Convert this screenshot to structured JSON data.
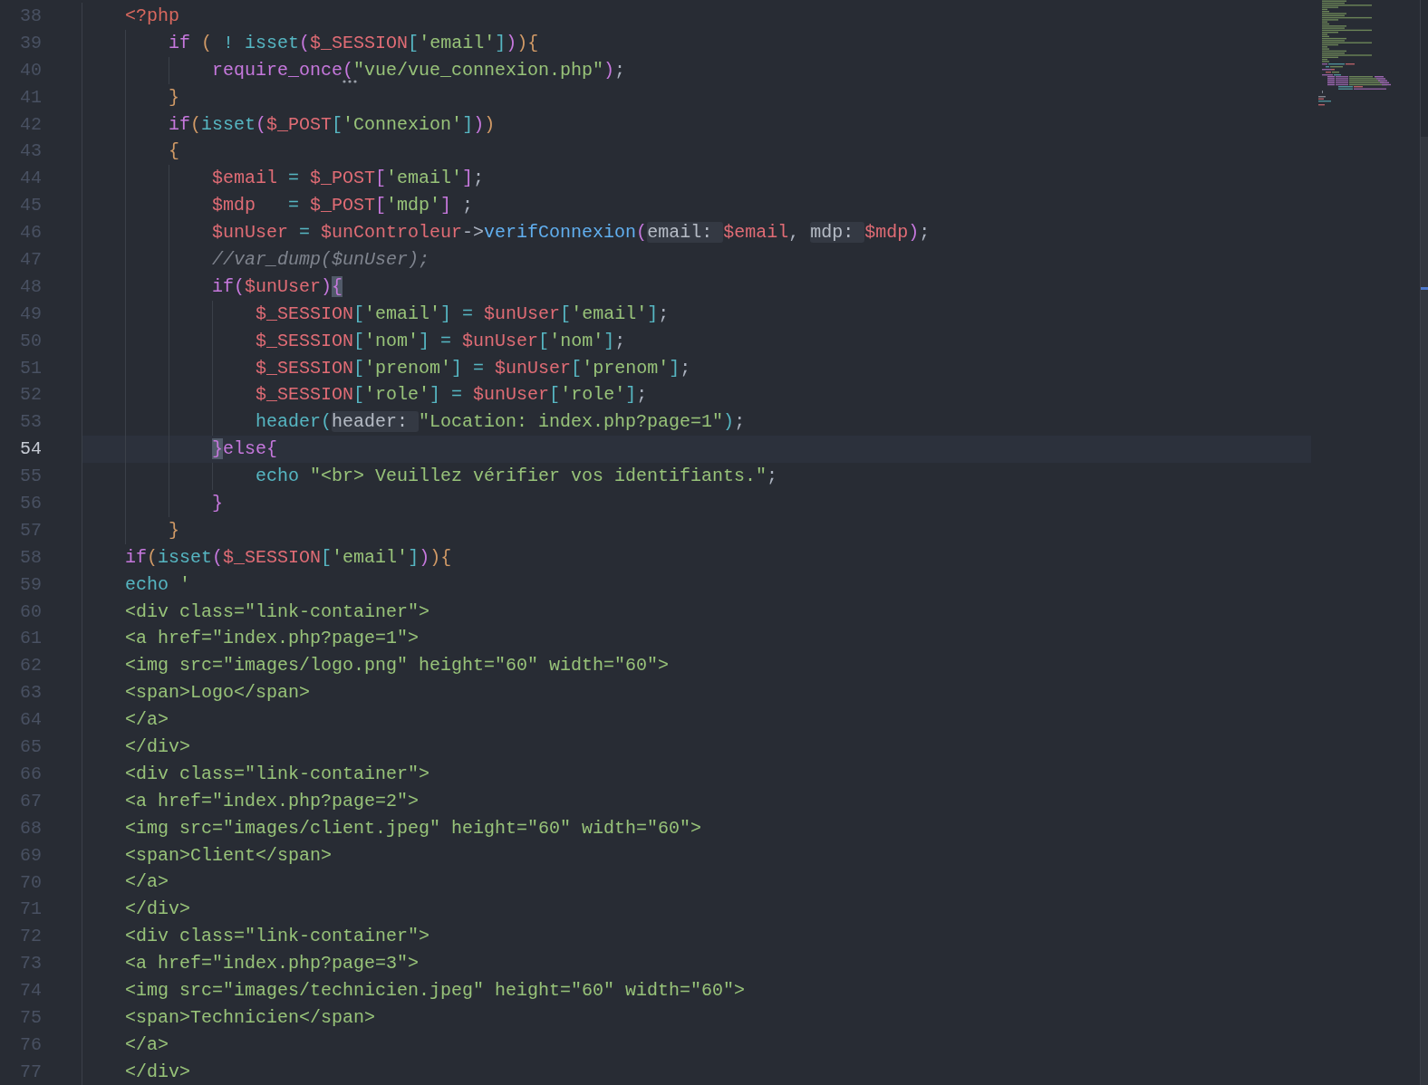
{
  "editor": {
    "lines": [
      {
        "number": "38",
        "selected": false,
        "tokens": [
          {
            "kind": "tag",
            "text": "<?php"
          }
        ],
        "children": [
          {
            "number": "39",
            "selected": false,
            "tokens": [
              {
                "kind": "keyword",
                "text": "if "
              },
              {
                "kind": "bracket1",
                "text": "( "
              },
              {
                "kind": "operator",
                "text": "! "
              },
              {
                "kind": "builtin",
                "text": "isset"
              },
              {
                "kind": "bracket2",
                "text": "("
              },
              {
                "kind": "variable",
                "text": "$_SESSION"
              },
              {
                "kind": "bracket3",
                "text": "["
              },
              {
                "kind": "string",
                "text": "'email'"
              },
              {
                "kind": "bracket3",
                "text": "]"
              },
              {
                "kind": "bracket2",
                "text": ")"
              },
              {
                "kind": "bracket1",
                "text": "){"
              }
            ],
            "children": [
              {
                "number": "40",
                "selected": false,
                "tokens": [
                  {
                    "kind": "keyword",
                    "text": "require_once"
                  },
                  {
                    "kind": "bracket2",
                    "text": "(",
                    "hinted": true
                  },
                  {
                    "kind": "string",
                    "text": "\"vue/vue_connexion.php\""
                  },
                  {
                    "kind": "bracket2",
                    "text": ")"
                  },
                  {
                    "kind": "plain",
                    "text": ";"
                  }
                ]
              }
            ]
          },
          {
            "number": "41",
            "selected": false,
            "tokens": [
              {
                "kind": "bracket1",
                "text": "}"
              }
            ]
          },
          {
            "number": "42",
            "selected": false,
            "tokens": [
              {
                "kind": "keyword",
                "text": "if"
              },
              {
                "kind": "bracket1",
                "text": "("
              },
              {
                "kind": "builtin",
                "text": "isset"
              },
              {
                "kind": "bracket2",
                "text": "("
              },
              {
                "kind": "variable",
                "text": "$_POST"
              },
              {
                "kind": "bracket3",
                "text": "["
              },
              {
                "kind": "string",
                "text": "'Connexion'"
              },
              {
                "kind": "bracket3",
                "text": "]"
              },
              {
                "kind": "bracket2",
                "text": ")"
              },
              {
                "kind": "bracket1",
                "text": ")"
              }
            ]
          },
          {
            "number": "43",
            "selected": false,
            "tokens": [
              {
                "kind": "bracket1",
                "text": "{"
              }
            ],
            "children": [
              {
                "number": "44",
                "selected": false,
                "tokens": [
                  {
                    "kind": "variable",
                    "text": "$email "
                  },
                  {
                    "kind": "operator",
                    "text": "= "
                  },
                  {
                    "kind": "variable",
                    "text": "$_POST"
                  },
                  {
                    "kind": "bracket2",
                    "text": "["
                  },
                  {
                    "kind": "string",
                    "text": "'email'"
                  },
                  {
                    "kind": "bracket2",
                    "text": "]"
                  },
                  {
                    "kind": "plain",
                    "text": ";"
                  }
                ]
              },
              {
                "number": "45",
                "selected": false,
                "tokens": [
                  {
                    "kind": "variable",
                    "text": "$mdp   "
                  },
                  {
                    "kind": "operator",
                    "text": "= "
                  },
                  {
                    "kind": "variable",
                    "text": "$_POST"
                  },
                  {
                    "kind": "bracket2",
                    "text": "["
                  },
                  {
                    "kind": "string",
                    "text": "'mdp'"
                  },
                  {
                    "kind": "bracket2",
                    "text": "]"
                  },
                  {
                    "kind": "plain",
                    "text": " ;"
                  }
                ]
              },
              {
                "number": "46",
                "selected": false,
                "tokens": [
                  {
                    "kind": "variable",
                    "text": "$unUser "
                  },
                  {
                    "kind": "operator",
                    "text": "= "
                  },
                  {
                    "kind": "variable",
                    "text": "$unControleur"
                  },
                  {
                    "kind": "plain",
                    "text": "->"
                  },
                  {
                    "kind": "method",
                    "text": "verifConnexion"
                  },
                  {
                    "kind": "bracket2",
                    "text": "("
                  },
                  {
                    "kind": "hint",
                    "text": "email:"
                  },
                  {
                    "kind": "variable",
                    "text": "$email"
                  },
                  {
                    "kind": "plain",
                    "text": ", "
                  },
                  {
                    "kind": "hint",
                    "text": "mdp:"
                  },
                  {
                    "kind": "variable",
                    "text": "$mdp"
                  },
                  {
                    "kind": "bracket2",
                    "text": ")"
                  },
                  {
                    "kind": "plain",
                    "text": ";"
                  }
                ]
              },
              {
                "number": "47",
                "selected": false,
                "tokens": [
                  {
                    "kind": "comment",
                    "text": "//var_dump($unUser);"
                  }
                ]
              },
              {
                "number": "48",
                "selected": false,
                "tokens": [
                  {
                    "kind": "keyword",
                    "text": "if"
                  },
                  {
                    "kind": "bracket2",
                    "text": "("
                  },
                  {
                    "kind": "variable",
                    "text": "$unUser"
                  },
                  {
                    "kind": "bracket2",
                    "text": ")"
                  },
                  {
                    "kind": "match",
                    "text": "{"
                  }
                ],
                "children": [
                  {
                    "number": "49",
                    "selected": false,
                    "tokens": [
                      {
                        "kind": "variable",
                        "text": "$_SESSION"
                      },
                      {
                        "kind": "bracket3",
                        "text": "["
                      },
                      {
                        "kind": "string",
                        "text": "'email'"
                      },
                      {
                        "kind": "bracket3",
                        "text": "] "
                      },
                      {
                        "kind": "operator",
                        "text": "= "
                      },
                      {
                        "kind": "variable",
                        "text": "$unUser"
                      },
                      {
                        "kind": "bracket3",
                        "text": "["
                      },
                      {
                        "kind": "string",
                        "text": "'email'"
                      },
                      {
                        "kind": "bracket3",
                        "text": "]"
                      },
                      {
                        "kind": "plain",
                        "text": ";"
                      }
                    ]
                  },
                  {
                    "number": "50",
                    "selected": false,
                    "tokens": [
                      {
                        "kind": "variable",
                        "text": "$_SESSION"
                      },
                      {
                        "kind": "bracket3",
                        "text": "["
                      },
                      {
                        "kind": "string",
                        "text": "'nom'"
                      },
                      {
                        "kind": "bracket3",
                        "text": "] "
                      },
                      {
                        "kind": "operator",
                        "text": "= "
                      },
                      {
                        "kind": "variable",
                        "text": "$unUser"
                      },
                      {
                        "kind": "bracket3",
                        "text": "["
                      },
                      {
                        "kind": "string",
                        "text": "'nom'"
                      },
                      {
                        "kind": "bracket3",
                        "text": "]"
                      },
                      {
                        "kind": "plain",
                        "text": ";"
                      }
                    ]
                  },
                  {
                    "number": "51",
                    "selected": false,
                    "tokens": [
                      {
                        "kind": "variable",
                        "text": "$_SESSION"
                      },
                      {
                        "kind": "bracket3",
                        "text": "["
                      },
                      {
                        "kind": "string",
                        "text": "'prenom'"
                      },
                      {
                        "kind": "bracket3",
                        "text": "] "
                      },
                      {
                        "kind": "operator",
                        "text": "= "
                      },
                      {
                        "kind": "variable",
                        "text": "$unUser"
                      },
                      {
                        "kind": "bracket3",
                        "text": "["
                      },
                      {
                        "kind": "string",
                        "text": "'prenom'"
                      },
                      {
                        "kind": "bracket3",
                        "text": "]"
                      },
                      {
                        "kind": "plain",
                        "text": ";"
                      }
                    ]
                  },
                  {
                    "number": "52",
                    "selected": false,
                    "tokens": [
                      {
                        "kind": "variable",
                        "text": "$_SESSION"
                      },
                      {
                        "kind": "bracket3",
                        "text": "["
                      },
                      {
                        "kind": "string",
                        "text": "'role'"
                      },
                      {
                        "kind": "bracket3",
                        "text": "] "
                      },
                      {
                        "kind": "operator",
                        "text": "= "
                      },
                      {
                        "kind": "variable",
                        "text": "$unUser"
                      },
                      {
                        "kind": "bracket3",
                        "text": "["
                      },
                      {
                        "kind": "string",
                        "text": "'role'"
                      },
                      {
                        "kind": "bracket3",
                        "text": "]"
                      },
                      {
                        "kind": "plain",
                        "text": ";"
                      }
                    ]
                  },
                  {
                    "number": "53",
                    "selected": false,
                    "tokens": [
                      {
                        "kind": "builtin",
                        "text": "header"
                      },
                      {
                        "kind": "bracket3",
                        "text": "("
                      },
                      {
                        "kind": "hint",
                        "text": "header:"
                      },
                      {
                        "kind": "string",
                        "text": "\"Location: index.php?page=1\""
                      },
                      {
                        "kind": "bracket3",
                        "text": ")"
                      },
                      {
                        "kind": "plain",
                        "text": ";"
                      }
                    ]
                  }
                ]
              },
              {
                "number": "54",
                "selected": true,
                "tokens": [
                  {
                    "kind": "match",
                    "text": "}"
                  },
                  {
                    "kind": "keyword",
                    "text": "else"
                  },
                  {
                    "kind": "bracket2",
                    "text": "{"
                  }
                ],
                "children": [
                  {
                    "number": "55",
                    "selected": false,
                    "tokens": [
                      {
                        "kind": "builtin",
                        "text": "echo "
                      },
                      {
                        "kind": "string",
                        "text": "\"<br> Veuillez vérifier vos identifiants.\""
                      },
                      {
                        "kind": "plain",
                        "text": ";"
                      }
                    ]
                  }
                ]
              },
              {
                "number": "56",
                "selected": false,
                "tokens": [
                  {
                    "kind": "bracket2",
                    "text": "}"
                  }
                ]
              }
            ]
          },
          {
            "number": "57",
            "selected": false,
            "tokens": [
              {
                "kind": "bracket1",
                "text": "}"
              }
            ]
          }
        ]
      },
      {
        "number": "58",
        "selected": false,
        "tokens": [
          {
            "kind": "keyword",
            "text": "if"
          },
          {
            "kind": "bracket1",
            "text": "("
          },
          {
            "kind": "builtin",
            "text": "isset"
          },
          {
            "kind": "bracket2",
            "text": "("
          },
          {
            "kind": "variable",
            "text": "$_SESSION"
          },
          {
            "kind": "bracket3",
            "text": "["
          },
          {
            "kind": "string",
            "text": "'email'"
          },
          {
            "kind": "bracket3",
            "text": "]"
          },
          {
            "kind": "bracket2",
            "text": ")"
          },
          {
            "kind": "bracket1",
            "text": "){"
          }
        ]
      },
      {
        "number": "59",
        "selected": false,
        "tokens": [
          {
            "kind": "builtin",
            "text": "echo "
          },
          {
            "kind": "string",
            "text": "'"
          }
        ]
      },
      {
        "number": "60",
        "selected": false,
        "tokens": [
          {
            "kind": "string",
            "text": "<div class=\"link-container\">"
          }
        ]
      },
      {
        "number": "61",
        "selected": false,
        "tokens": [
          {
            "kind": "string",
            "text": "<a href=\"index.php?page=1\">"
          }
        ]
      },
      {
        "number": "62",
        "selected": false,
        "tokens": [
          {
            "kind": "string",
            "text": "<img src=\"images/logo.png\" height=\"60\" width=\"60\">"
          }
        ]
      },
      {
        "number": "63",
        "selected": false,
        "tokens": [
          {
            "kind": "string",
            "text": "<span>Logo</span>"
          }
        ]
      },
      {
        "number": "64",
        "selected": false,
        "tokens": [
          {
            "kind": "string",
            "text": "</a>"
          }
        ]
      },
      {
        "number": "65",
        "selected": false,
        "tokens": [
          {
            "kind": "string",
            "text": "</div>"
          }
        ]
      },
      {
        "number": "66",
        "selected": false,
        "tokens": [
          {
            "kind": "string",
            "text": "<div class=\"link-container\">"
          }
        ]
      },
      {
        "number": "67",
        "selected": false,
        "tokens": [
          {
            "kind": "string",
            "text": "<a href=\"index.php?page=2\">"
          }
        ]
      },
      {
        "number": "68",
        "selected": false,
        "tokens": [
          {
            "kind": "string",
            "text": "<img src=\"images/client.jpeg\" height=\"60\" width=\"60\">"
          }
        ]
      },
      {
        "number": "69",
        "selected": false,
        "tokens": [
          {
            "kind": "string",
            "text": "<span>Client</span>"
          }
        ]
      },
      {
        "number": "70",
        "selected": false,
        "tokens": [
          {
            "kind": "string",
            "text": "</a>"
          }
        ]
      },
      {
        "number": "71",
        "selected": false,
        "tokens": [
          {
            "kind": "string",
            "text": "</div>"
          }
        ]
      },
      {
        "number": "72",
        "selected": false,
        "tokens": [
          {
            "kind": "string",
            "text": "<div class=\"link-container\">"
          }
        ]
      },
      {
        "number": "73",
        "selected": false,
        "tokens": [
          {
            "kind": "string",
            "text": "<a href=\"index.php?page=3\">"
          }
        ]
      },
      {
        "number": "74",
        "selected": false,
        "tokens": [
          {
            "kind": "string",
            "text": "<img src=\"images/technicien.jpeg\" height=\"60\" width=\"60\">"
          }
        ]
      },
      {
        "number": "75",
        "selected": false,
        "tokens": [
          {
            "kind": "string",
            "text": "<span>Technicien</span>"
          }
        ]
      },
      {
        "number": "76",
        "selected": false,
        "tokens": [
          {
            "kind": "string",
            "text": "</a>"
          }
        ]
      },
      {
        "number": "77",
        "selected": false,
        "tokens": [
          {
            "kind": "string",
            "text": "</div>"
          }
        ]
      }
    ]
  }
}
